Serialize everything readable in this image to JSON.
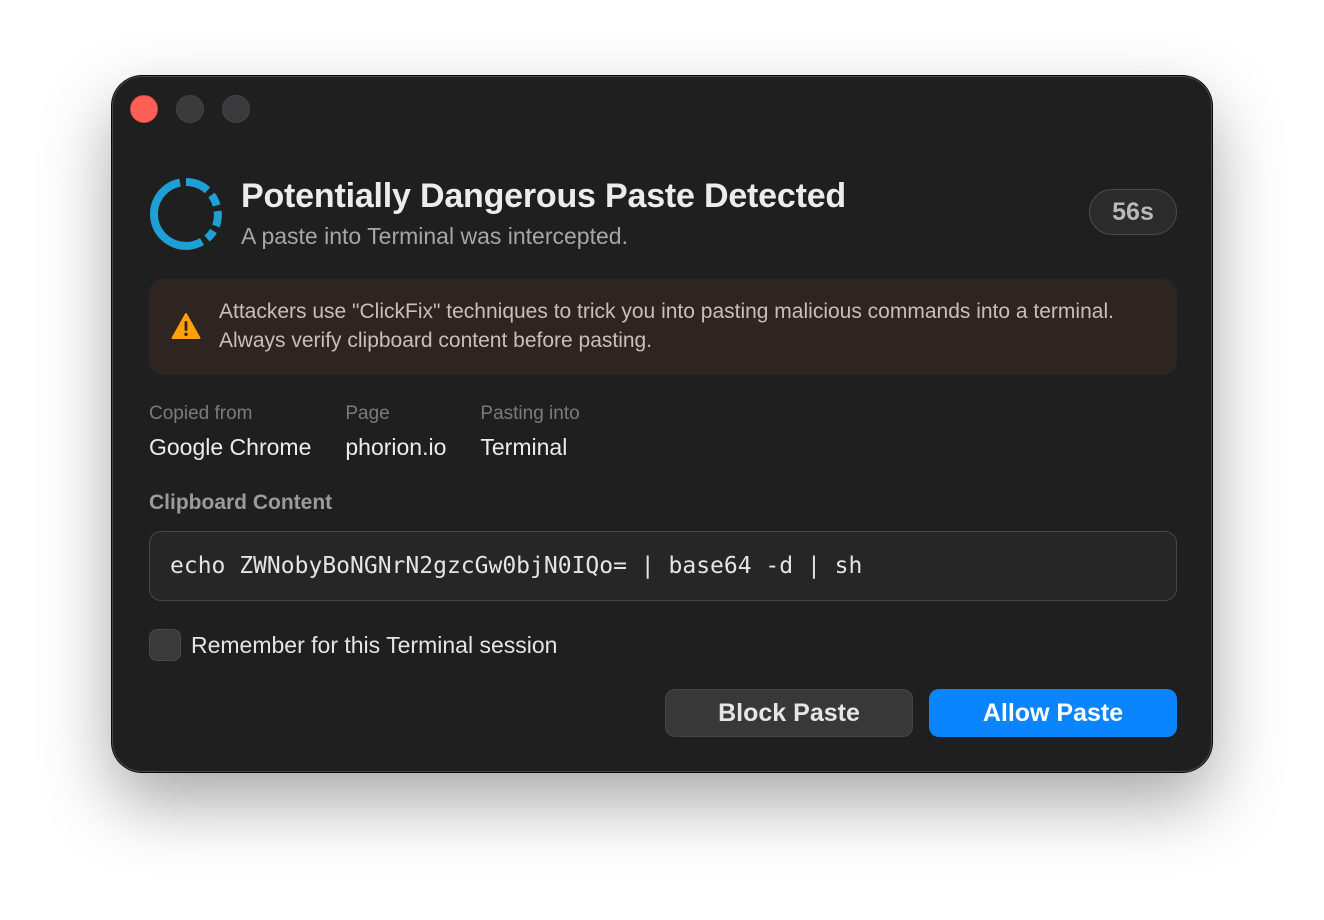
{
  "window": {
    "controls": [
      "close",
      "minimize",
      "maximize"
    ]
  },
  "header": {
    "title": "Potentially Dangerous Paste Detected",
    "subtitle": "A paste into Terminal was intercepted.",
    "timer": "56s",
    "icon": "spinner-icon"
  },
  "warning": {
    "icon": "warning-triangle-icon",
    "text": "Attackers use \"ClickFix\" techniques to trick you into pasting malicious commands into a terminal. Always verify clipboard content before pasting."
  },
  "meta": [
    {
      "label": "Copied from",
      "value": "Google Chrome"
    },
    {
      "label": "Page",
      "value": "phorion.io"
    },
    {
      "label": "Pasting into",
      "value": "Terminal"
    }
  ],
  "clipboard": {
    "label": "Clipboard Content",
    "content": "echo ZWNobyBoNGNrN2gzcGw0bjN0IQo= | base64 -d | sh"
  },
  "remember": {
    "label": "Remember for this Terminal session",
    "checked": false
  },
  "actions": {
    "block_label": "Block Paste",
    "allow_label": "Allow Paste"
  },
  "colors": {
    "accent": "#0a84ff",
    "spinner": "#1e9fd6",
    "warning": "#ff9f0a",
    "close": "#fe5f57"
  }
}
